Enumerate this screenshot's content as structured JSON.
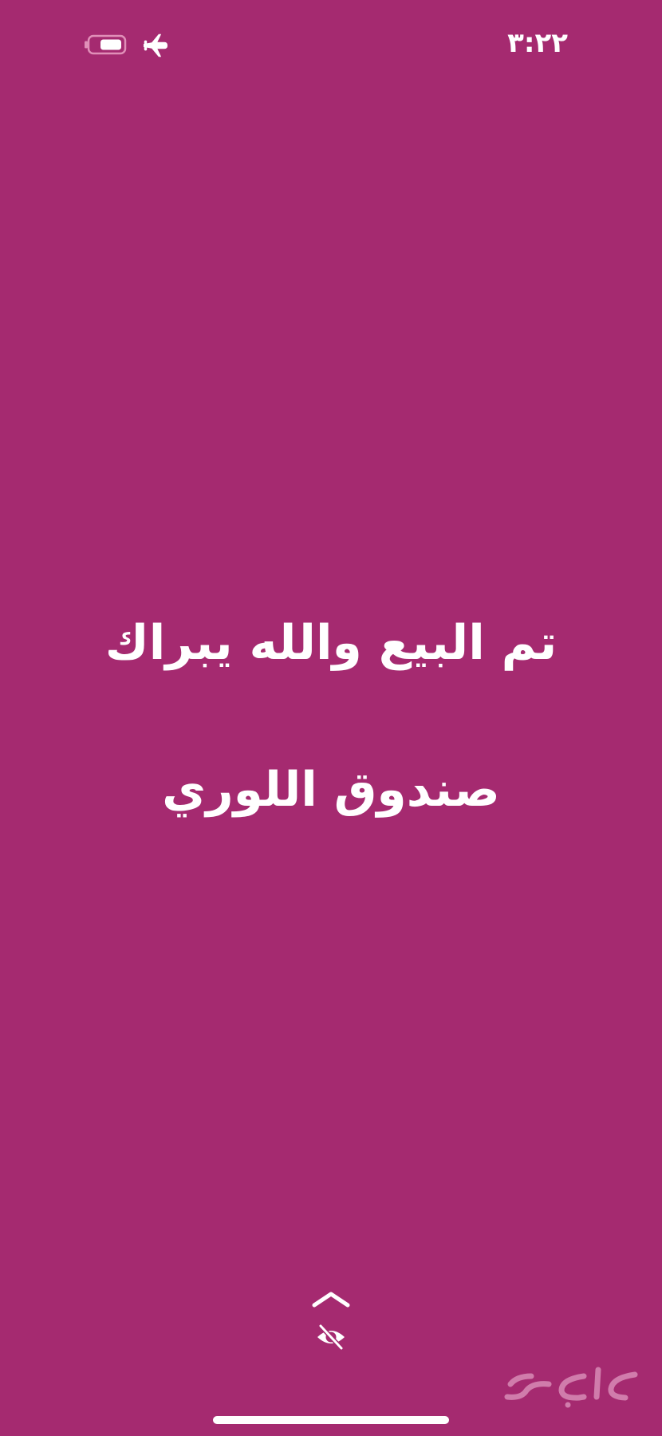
{
  "status_bar": {
    "time": "٣:٢٢",
    "airplane_mode": true,
    "battery_icon": "battery-icon",
    "airplane_icon": "airplane-icon"
  },
  "story": {
    "line1": "تم البيع والله يبراك",
    "line2": "صندوق اللوري",
    "background_color": "#a52a70",
    "text_color": "#ffffff"
  },
  "controls": {
    "swipe_up_icon": "chevron-up-icon",
    "visibility_icon": "eye-slash-icon"
  },
  "watermark": {
    "logo_text": "حراج"
  }
}
